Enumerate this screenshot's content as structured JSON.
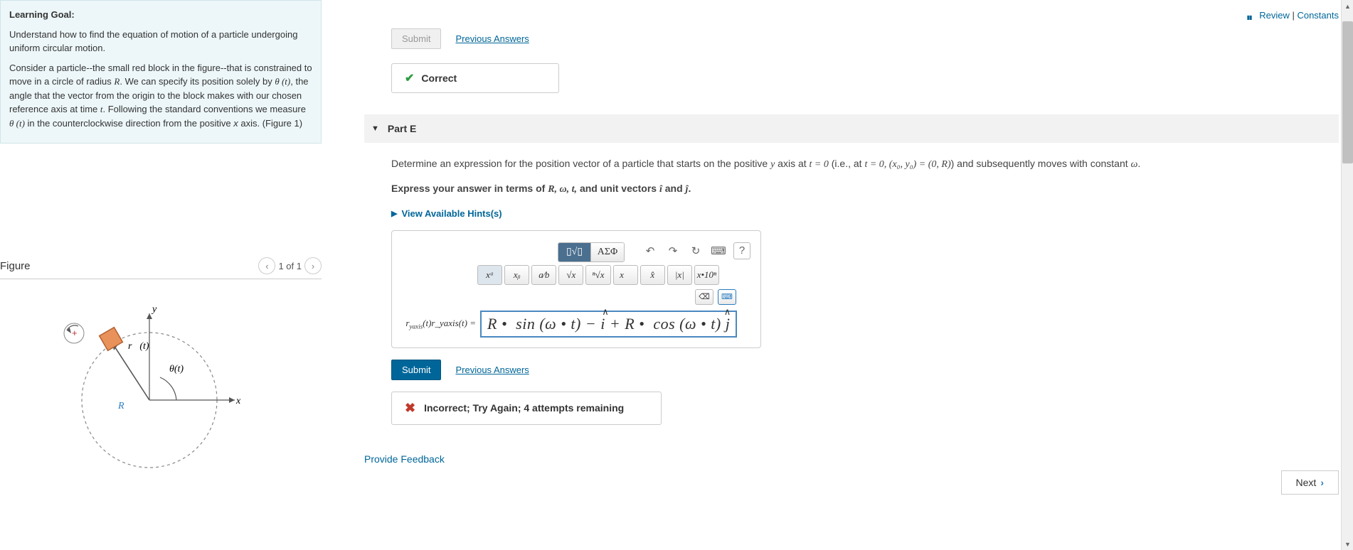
{
  "learning_goal": {
    "heading": "Learning Goal:",
    "para1": "Understand how to find the equation of motion of a particle undergoing uniform circular motion.",
    "para2_a": "Consider a particle--the small red block in the figure--that is constrained to move in a circle of radius ",
    "para2_R": "R",
    "para2_b": ". We can specify its position solely by ",
    "para2_theta": "θ (t)",
    "para2_c": ", the angle that the vector from the origin to the block makes with our chosen reference axis at time ",
    "para2_t": "t",
    "para2_d": ". Following the standard conventions we measure ",
    "para2_theta2": "θ (t)",
    "para2_e": " in the counterclockwise direction from the positive ",
    "para2_x": "x",
    "para2_f": " axis. (Figure 1)"
  },
  "figure": {
    "title": "Figure",
    "counter": "1 of 1"
  },
  "top_links": {
    "review": "Review",
    "constants": "Constants"
  },
  "prev_part": {
    "submit": "Submit",
    "prev_answers": "Previous Answers",
    "correct": "Correct"
  },
  "part_e": {
    "title": "Part E",
    "prompt_a": "Determine an expression for the position vector of a particle that starts on the positive ",
    "prompt_italic_y": "y",
    "prompt_b": " axis at ",
    "prompt_math1": "t = 0",
    "prompt_c": " (i.e., at ",
    "prompt_math2": "t = 0, (x₀, y₀) = (0, R)",
    "prompt_d": ") and subsequently moves with constant ",
    "prompt_omega": "ω",
    "prompt_e": ".",
    "instruct_a": "Express your answer in terms of ",
    "instruct_vars": "R, ω, t,",
    "instruct_b": " and unit vectors ",
    "instruct_i": "î",
    "instruct_and": " and ",
    "instruct_j": "ĵ",
    "instruct_c": ".",
    "hints": "View Available Hints(s)",
    "toolbar": {
      "templates": "▯√▯",
      "greek": "ΑΣΦ"
    },
    "icons": {
      "undo": "↶",
      "redo": "↷",
      "reset": "↻",
      "keyboard": "⌨",
      "help": "?"
    },
    "math_buttons": {
      "xa": "xᵃ",
      "xb": "xᵦ",
      "frac": "a⁄b",
      "sqrt": "√x",
      "nroot": "ⁿ√x",
      "vec": "x⃗",
      "hat": "x̂",
      "abs": "|x|",
      "sci": "x•10ⁿ"
    },
    "small_icons": {
      "bksp": "⌫",
      "kb": "⌨"
    },
    "answer_label": "r_yaxis(t)r_yaxis(t) =",
    "answer_value": "R •  sin (ω • t) − î + R •  cos (ω • t) ĵ",
    "submit": "Submit",
    "prev_answers": "Previous Answers",
    "incorrect": "Incorrect; Try Again; 4 attempts remaining"
  },
  "footer": {
    "feedback": "Provide Feedback",
    "next": "Next"
  }
}
